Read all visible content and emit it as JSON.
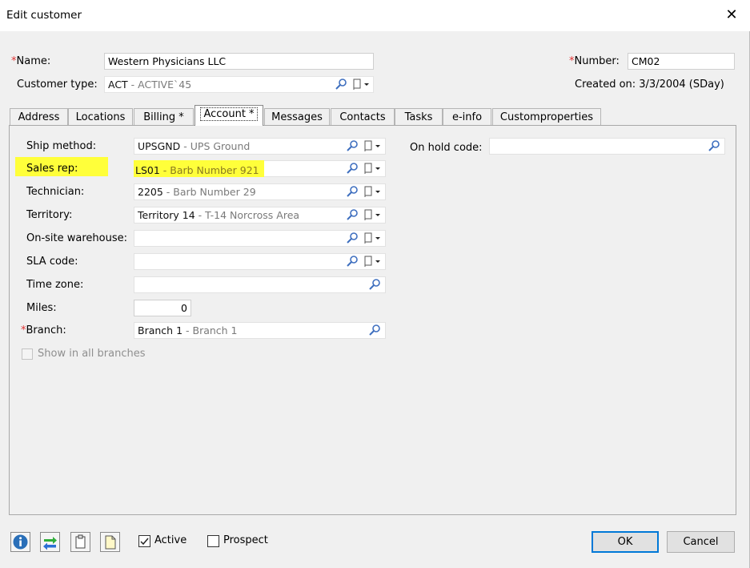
{
  "window": {
    "title": "Edit customer"
  },
  "header": {
    "name_label": "Name:",
    "name_value": "Western Physicians LLC",
    "customer_type_label": "Customer type:",
    "customer_type_code": "ACT",
    "customer_type_desc": " - ACTIVE`45",
    "number_label": "Number:",
    "number_value": "CM02",
    "created_on": "Created on: 3/3/2004 (SDay)"
  },
  "tabs": [
    {
      "label": "Address"
    },
    {
      "label": "Locations"
    },
    {
      "label": "Billing *"
    },
    {
      "label": "Account *"
    },
    {
      "label": "Messages"
    },
    {
      "label": "Contacts"
    },
    {
      "label": "Tasks"
    },
    {
      "label": "e-info"
    },
    {
      "label": "Customproperties"
    }
  ],
  "account": {
    "ship_method": {
      "label": "Ship method:",
      "code": "UPSGND",
      "desc": " - UPS Ground"
    },
    "sales_rep": {
      "label": "Sales rep:",
      "code": "LS01",
      "desc": " - Barb Number 921"
    },
    "technician": {
      "label": "Technician:",
      "code": "2205",
      "desc": " - Barb Number 29"
    },
    "territory": {
      "label": "Territory:",
      "code": "Territory 14",
      "desc": " - T-14 Norcross Area"
    },
    "onsite_warehouse": {
      "label": "On-site warehouse:",
      "code": "",
      "desc": ""
    },
    "sla_code": {
      "label": "SLA code:",
      "code": "",
      "desc": ""
    },
    "time_zone": {
      "label": "Time zone:",
      "code": "",
      "desc": ""
    },
    "miles": {
      "label": "Miles:",
      "value": "0"
    },
    "branch": {
      "label": "Branch:",
      "code": "Branch 1",
      "desc": " - Branch 1"
    },
    "show_all_branches": {
      "label": "Show in all branches",
      "checked": false
    },
    "on_hold_code": {
      "label": "On hold code:",
      "value": ""
    }
  },
  "footer": {
    "active_label": "Active",
    "active_checked": true,
    "prospect_label": "Prospect",
    "prospect_checked": false,
    "ok_label": "OK",
    "cancel_label": "Cancel"
  },
  "colors": {
    "required": "#e03030",
    "highlight": "#ffff3a",
    "info_icon": "#2a6fb8",
    "swap_green": "#2fae3a",
    "swap_blue": "#2b6fd6"
  }
}
